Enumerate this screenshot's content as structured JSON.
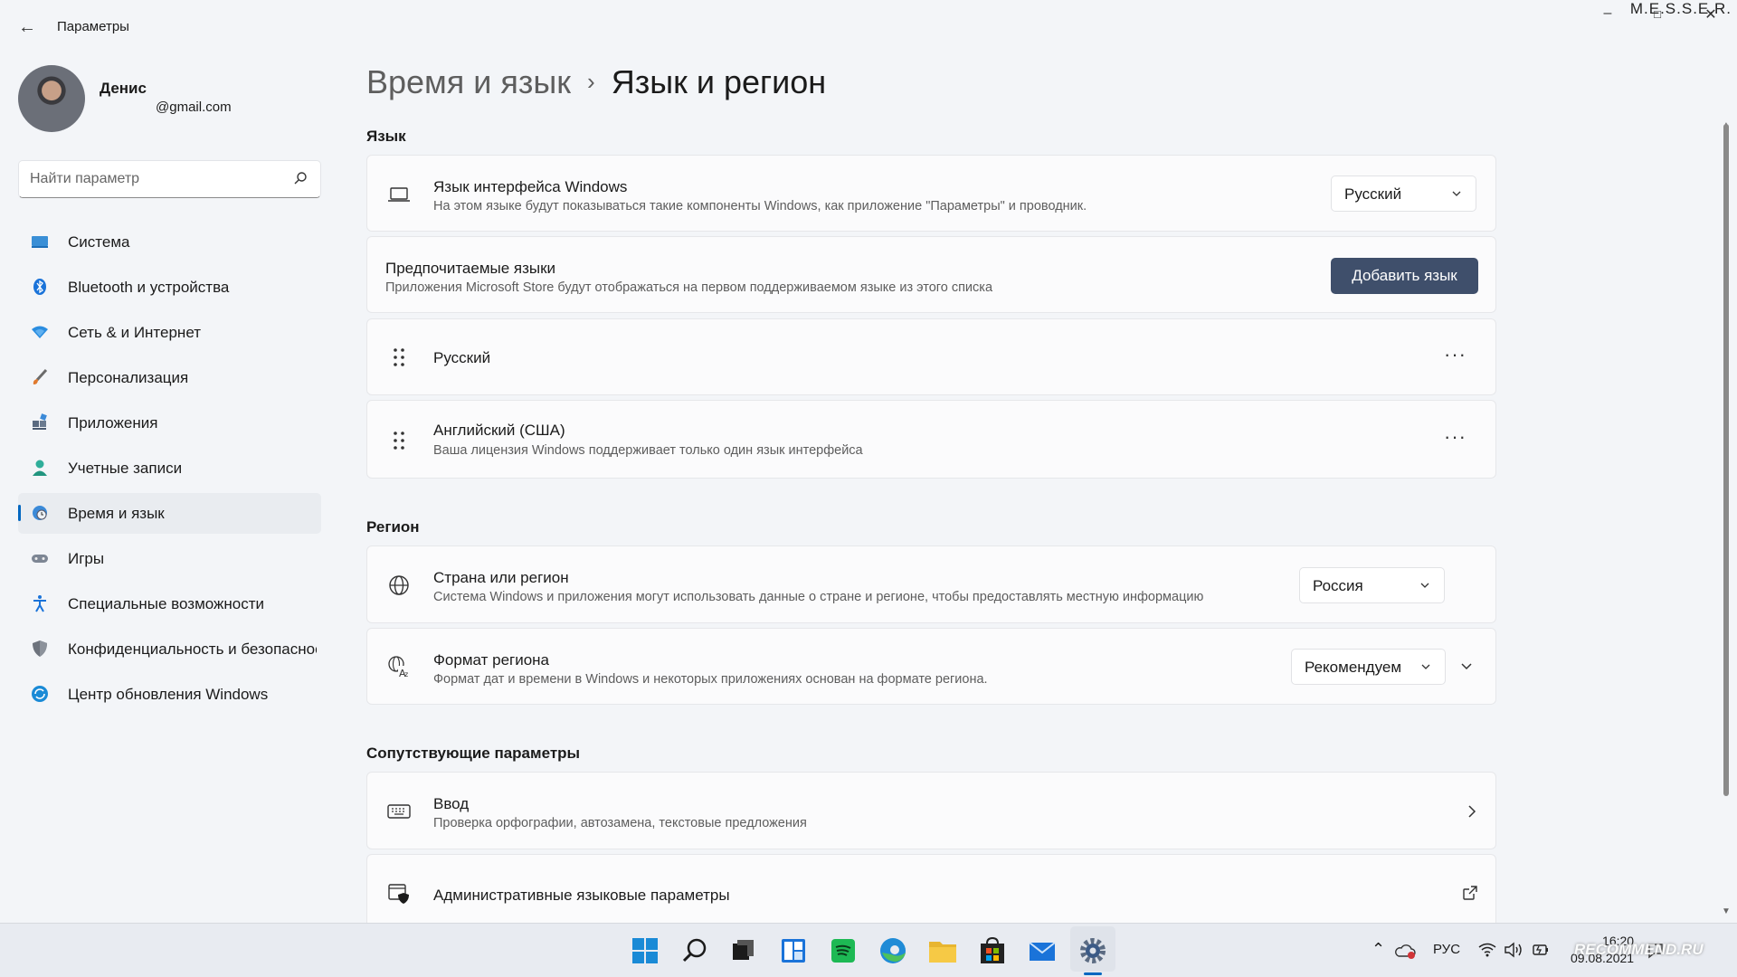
{
  "window": {
    "title": "Параметры",
    "watermark": "M.E.S.S.E.R."
  },
  "profile": {
    "name": "Денис",
    "email": "@gmail.com"
  },
  "search": {
    "placeholder": "Найти параметр"
  },
  "sidebar": {
    "items": [
      {
        "label": "Система",
        "icon": "monitor-icon"
      },
      {
        "label": "Bluetooth и устройства",
        "icon": "bluetooth-icon"
      },
      {
        "label": "Сеть & и Интернет",
        "icon": "wifi-icon"
      },
      {
        "label": "Персонализация",
        "icon": "brush-icon"
      },
      {
        "label": "Приложения",
        "icon": "apps-icon"
      },
      {
        "label": "Учетные записи",
        "icon": "person-icon"
      },
      {
        "label": "Время и язык",
        "icon": "globe-clock-icon",
        "active": true
      },
      {
        "label": "Игры",
        "icon": "gamepad-icon"
      },
      {
        "label": "Специальные возможности",
        "icon": "accessibility-icon"
      },
      {
        "label": "Конфиденциальность и безопасность",
        "icon": "shield-icon"
      },
      {
        "label": "Центр обновления Windows",
        "icon": "update-icon"
      }
    ]
  },
  "breadcrumb": {
    "parent": "Время и язык",
    "separator": "›",
    "current": "Язык и регион"
  },
  "language": {
    "section_title": "Язык",
    "display": {
      "title": "Язык интерфейса Windows",
      "desc": "На этом языке будут показываться такие компоненты Windows, как приложение \"Параметры\" и проводник.",
      "value": "Русский"
    },
    "preferred": {
      "title": "Предпочитаемые языки",
      "desc": "Приложения Microsoft Store будут отображаться на первом поддерживаемом языке из этого списка",
      "button": "Добавить язык"
    },
    "items": [
      {
        "title": "Русский",
        "desc": "",
        "more": "···"
      },
      {
        "title": "Английский (США)",
        "desc": "Ваша лицензия Windows поддерживает только один язык интерфейса",
        "more": "···"
      }
    ]
  },
  "region": {
    "section_title": "Регион",
    "country": {
      "title": "Страна или регион",
      "desc": "Система Windows и приложения могут использовать данные о стране и регионе, чтобы предоставлять местную информацию",
      "value": "Россия"
    },
    "format": {
      "title": "Формат региона",
      "desc": "Формат дат и времени в Windows и некоторых приложениях основан на формате региона.",
      "value": "Рекомендуем"
    }
  },
  "related": {
    "section_title": "Сопутствующие параметры",
    "typing": {
      "title": "Ввод",
      "desc": "Проверка орфографии, автозамена, текстовые предложения"
    },
    "admin": {
      "title": "Административные языковые параметры"
    }
  },
  "taskbar": {
    "apps": [
      "start-icon",
      "search-icon",
      "task-view-icon",
      "widgets-icon",
      "spotify-icon",
      "edge-icon",
      "file-explorer-icon",
      "store-icon",
      "mail-icon",
      "settings-icon"
    ],
    "language": "РУС",
    "time": "16:20",
    "date": "09.08.2021"
  },
  "watermark_site": "RECOMMEND.RU",
  "colors": {
    "accent": "#0067c0",
    "button": "#3f4f6b",
    "background": "#f3f5f8",
    "card": "#fbfbfc"
  }
}
